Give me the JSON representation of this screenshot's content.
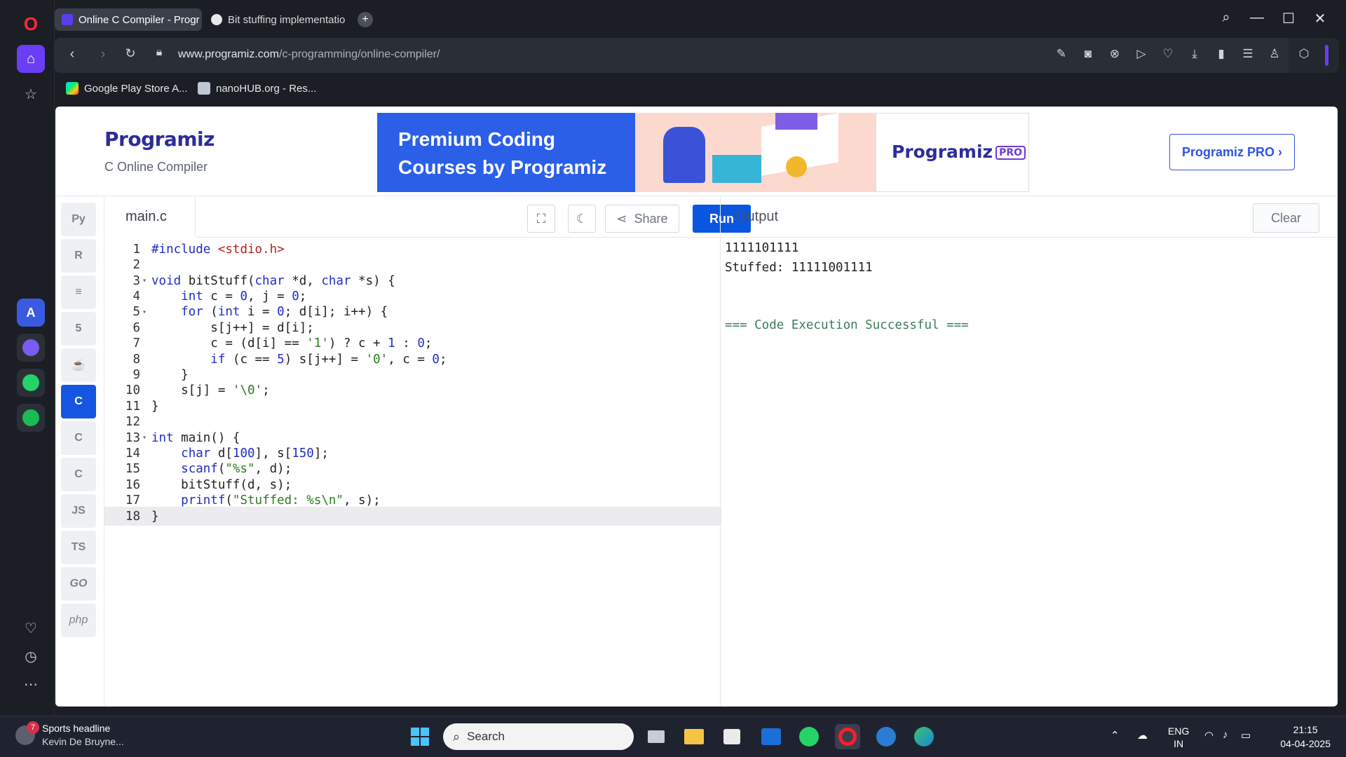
{
  "browser": {
    "tabs": [
      {
        "title": "Online C Compiler - Progr",
        "active": true
      },
      {
        "title": "Bit stuffing implementatio",
        "active": false
      }
    ],
    "url_host": "www.programiz.com",
    "url_path": "/c-programming/online-compiler/",
    "bookmarks": [
      {
        "label": "Google Play Store A..."
      },
      {
        "label": "nanoHUB.org - Res..."
      }
    ]
  },
  "header": {
    "logo": "Programiz",
    "subtitle": "C Online Compiler",
    "banner_line1": "Premium Coding",
    "banner_line2": "Courses by Programiz",
    "banner_logo": "Programiz",
    "banner_pro": "PRO",
    "pro_button": "Programiz PRO ›"
  },
  "languages": [
    {
      "name": "python-icon",
      "label": "Py"
    },
    {
      "name": "r-icon",
      "label": "R"
    },
    {
      "name": "sql-icon",
      "label": "≡"
    },
    {
      "name": "html5-icon",
      "label": "5"
    },
    {
      "name": "java-icon",
      "label": "☕"
    },
    {
      "name": "c-icon",
      "label": "C"
    },
    {
      "name": "cpp-icon",
      "label": "C"
    },
    {
      "name": "csharp-icon",
      "label": "C"
    },
    {
      "name": "js-icon",
      "label": "JS"
    },
    {
      "name": "ts-icon",
      "label": "TS"
    },
    {
      "name": "go-icon",
      "label": "GO"
    },
    {
      "name": "php-icon",
      "label": "php"
    }
  ],
  "editor": {
    "file_name": "main.c",
    "share_label": "Share",
    "run_label": "Run",
    "lines": [
      "#include <stdio.h>",
      "",
      "void bitStuff(char *d, char *s) {",
      "    int c = 0, j = 0;",
      "    for (int i = 0; d[i]; i++) {",
      "        s[j++] = d[i];",
      "        c = (d[i] == '1') ? c + 1 : 0;",
      "        if (c == 5) s[j++] = '0', c = 0;",
      "    }",
      "    s[j] = '\\0';",
      "}",
      "",
      "int main() {",
      "    char d[100], s[150];",
      "    scanf(\"%s\", d);",
      "    bitStuff(d, s);",
      "    printf(\"Stuffed: %s\\n\", s);",
      "}"
    ]
  },
  "output": {
    "title": "Output",
    "clear_label": "Clear",
    "line1": "1111101111",
    "line2": "Stuffed: 11111001111",
    "success": "=== Code Execution Successful ==="
  },
  "taskbar": {
    "news_badge": "7",
    "news_title": "Sports headline",
    "news_sub": "Kevin De Bruyne...",
    "search_placeholder": "Search",
    "lang_line1": "ENG",
    "lang_line2": "IN",
    "time": "21:15",
    "date": "04-04-2025"
  }
}
